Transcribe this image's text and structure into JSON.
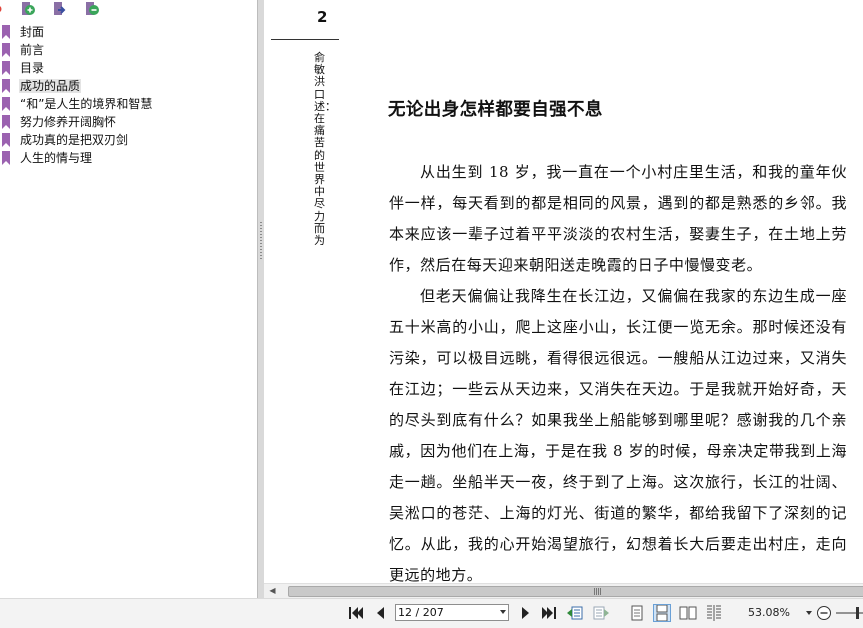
{
  "sidebar": {
    "toolbar": [
      {
        "icon": "add-bookmark-icon",
        "color": "#3aa55a"
      },
      {
        "icon": "move-bookmark-icon",
        "color": "#3a4fa0"
      },
      {
        "icon": "remove-bookmark-icon",
        "color": "#3aa55a"
      }
    ],
    "bookmarks": [
      {
        "label": "封面",
        "selected": false
      },
      {
        "label": "前言",
        "selected": false
      },
      {
        "label": "目录",
        "selected": false
      },
      {
        "label": "成功的品质",
        "selected": true
      },
      {
        "label": "“和”是人生的境界和智慧",
        "selected": false
      },
      {
        "label": "努力修养开阔胸怀",
        "selected": false
      },
      {
        "label": "成功真的是把双刃剑",
        "selected": false
      },
      {
        "label": "人生的情与理",
        "selected": false
      }
    ],
    "bookmark_color": "#9b62b0"
  },
  "document": {
    "page_number": "2",
    "running_head": "俞敏洪口述：在痛苦的世界中尽力而为",
    "chapter_title": "无论出身怎样都要自强不息",
    "paragraphs": [
      "从出生到 18 岁，我一直在一个小村庄里生活，和我的童年伙伴一样，每天看到的都是相同的风景，遇到的都是熟悉的乡邻。我本来应该一辈子过着平平淡淡的农村生活，娶妻生子，在土地上劳作，然后在每天迎来朝阳送走晚霞的日子中慢慢变老。",
      "但老天偏偏让我降生在长江边，又偏偏在我家的东边生成一座五十米高的小山，爬上这座小山，长江便一览无余。那时候还没有污染，可以极目远眺，看得很远很远。一艘船从江边过来，又消失在江边；一些云从天边来，又消失在天边。于是我就开始好奇，天的尽头到底有什么？如果我坐上船能够到哪里呢？感谢我的几个亲戚，因为他们在上海，于是在我 8 岁的时候，母亲决定带我到上海走一趟。坐船半天一夜，终于到了上海。这次旅行，长江的壮阔、吴淞口的苍茫、上海的灯光、街道的繁华，都给我留下了深刻的记忆。从此，我的心开始渴望旅行，幻想着长大后要走出村庄，走向更远的地方。"
    ]
  },
  "toolbar": {
    "page_field": "12 / 207",
    "zoom": "53.08%",
    "nav": [
      "first-page-icon",
      "previous-page-icon",
      "next-page-icon",
      "last-page-icon"
    ],
    "actions": [
      "previous-view-icon",
      "next-view-icon"
    ],
    "view_modes": [
      "single-page-icon",
      "continuous-icon",
      "facing-icon",
      "continuous-facing-icon"
    ],
    "active_view_mode": "continuous-icon",
    "accent": "#6aa0d6"
  }
}
